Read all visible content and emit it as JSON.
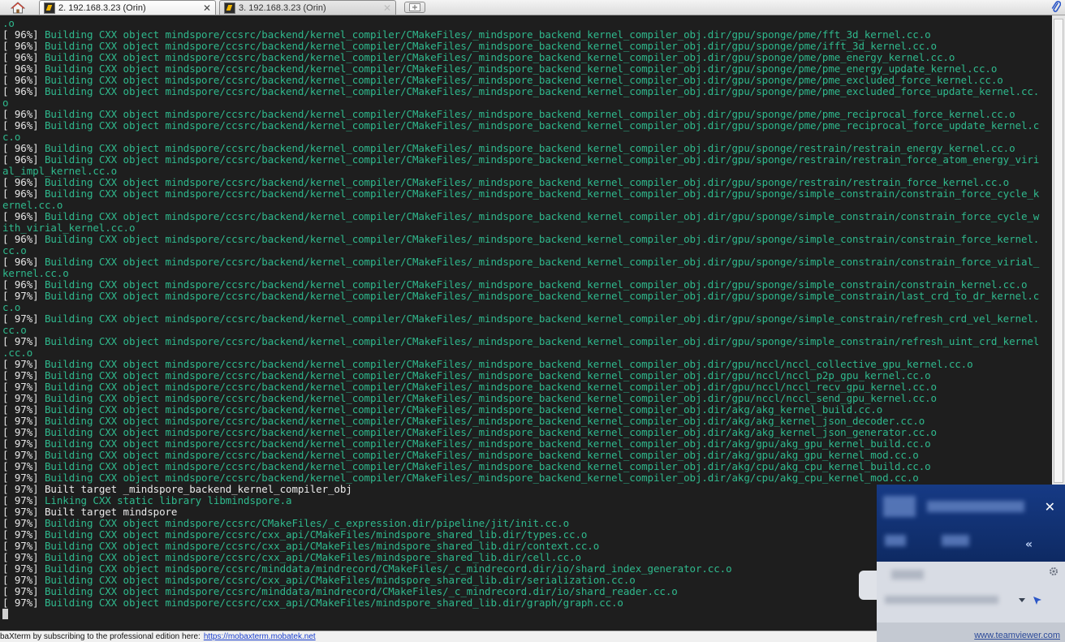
{
  "tabs": [
    {
      "label": "2. 192.168.3.23 (Orin)",
      "active": true
    },
    {
      "label": "3. 192.168.3.23 (Orin)",
      "active": false
    }
  ],
  "colors": {
    "green_text": "#2fb98d",
    "white_text": "#eaeaea",
    "background": "#1e1e1e"
  },
  "icons": {
    "home": "home-icon",
    "terminal_tab": "ssh-terminal-icon",
    "new_tab": "new-tab-icon",
    "attach": "paperclip-icon",
    "close": "close-icon"
  },
  "terminal": {
    "lines": [
      {
        "type": "cont",
        "text": ".o"
      },
      {
        "type": "green",
        "pct": "[ 96%]",
        "msg": " Building CXX object mindspore/ccsrc/backend/kernel_compiler/CMakeFiles/_mindspore_backend_kernel_compiler_obj.dir/gpu/sponge/pme/fft_3d_kernel.cc.o"
      },
      {
        "type": "green",
        "pct": "[ 96%]",
        "msg": " Building CXX object mindspore/ccsrc/backend/kernel_compiler/CMakeFiles/_mindspore_backend_kernel_compiler_obj.dir/gpu/sponge/pme/ifft_3d_kernel.cc.o"
      },
      {
        "type": "green",
        "pct": "[ 96%]",
        "msg": " Building CXX object mindspore/ccsrc/backend/kernel_compiler/CMakeFiles/_mindspore_backend_kernel_compiler_obj.dir/gpu/sponge/pme/pme_energy_kernel.cc.o"
      },
      {
        "type": "green",
        "pct": "[ 96%]",
        "msg": " Building CXX object mindspore/ccsrc/backend/kernel_compiler/CMakeFiles/_mindspore_backend_kernel_compiler_obj.dir/gpu/sponge/pme/pme_energy_update_kernel.cc.o"
      },
      {
        "type": "green",
        "pct": "[ 96%]",
        "msg": " Building CXX object mindspore/ccsrc/backend/kernel_compiler/CMakeFiles/_mindspore_backend_kernel_compiler_obj.dir/gpu/sponge/pme/pme_excluded_force_kernel.cc.o"
      },
      {
        "type": "green",
        "pct": "[ 96%]",
        "msg": " Building CXX object mindspore/ccsrc/backend/kernel_compiler/CMakeFiles/_mindspore_backend_kernel_compiler_obj.dir/gpu/sponge/pme/pme_excluded_force_update_kernel.cc."
      },
      {
        "type": "cont",
        "text": "o"
      },
      {
        "type": "green",
        "pct": "[ 96%]",
        "msg": " Building CXX object mindspore/ccsrc/backend/kernel_compiler/CMakeFiles/_mindspore_backend_kernel_compiler_obj.dir/gpu/sponge/pme/pme_reciprocal_force_kernel.cc.o"
      },
      {
        "type": "green",
        "pct": "[ 96%]",
        "msg": " Building CXX object mindspore/ccsrc/backend/kernel_compiler/CMakeFiles/_mindspore_backend_kernel_compiler_obj.dir/gpu/sponge/pme/pme_reciprocal_force_update_kernel.c"
      },
      {
        "type": "cont",
        "text": "c.o"
      },
      {
        "type": "green",
        "pct": "[ 96%]",
        "msg": " Building CXX object mindspore/ccsrc/backend/kernel_compiler/CMakeFiles/_mindspore_backend_kernel_compiler_obj.dir/gpu/sponge/restrain/restrain_energy_kernel.cc.o"
      },
      {
        "type": "green",
        "pct": "[ 96%]",
        "msg": " Building CXX object mindspore/ccsrc/backend/kernel_compiler/CMakeFiles/_mindspore_backend_kernel_compiler_obj.dir/gpu/sponge/restrain/restrain_force_atom_energy_viri"
      },
      {
        "type": "cont",
        "text": "al_impl_kernel.cc.o"
      },
      {
        "type": "green",
        "pct": "[ 96%]",
        "msg": " Building CXX object mindspore/ccsrc/backend/kernel_compiler/CMakeFiles/_mindspore_backend_kernel_compiler_obj.dir/gpu/sponge/restrain/restrain_force_kernel.cc.o"
      },
      {
        "type": "green",
        "pct": "[ 96%]",
        "msg": " Building CXX object mindspore/ccsrc/backend/kernel_compiler/CMakeFiles/_mindspore_backend_kernel_compiler_obj.dir/gpu/sponge/simple_constrain/constrain_force_cycle_k"
      },
      {
        "type": "cont",
        "text": "ernel.cc.o"
      },
      {
        "type": "green",
        "pct": "[ 96%]",
        "msg": " Building CXX object mindspore/ccsrc/backend/kernel_compiler/CMakeFiles/_mindspore_backend_kernel_compiler_obj.dir/gpu/sponge/simple_constrain/constrain_force_cycle_w"
      },
      {
        "type": "cont",
        "text": "ith_virial_kernel.cc.o"
      },
      {
        "type": "green",
        "pct": "[ 96%]",
        "msg": " Building CXX object mindspore/ccsrc/backend/kernel_compiler/CMakeFiles/_mindspore_backend_kernel_compiler_obj.dir/gpu/sponge/simple_constrain/constrain_force_kernel."
      },
      {
        "type": "cont",
        "text": "cc.o"
      },
      {
        "type": "green",
        "pct": "[ 96%]",
        "msg": " Building CXX object mindspore/ccsrc/backend/kernel_compiler/CMakeFiles/_mindspore_backend_kernel_compiler_obj.dir/gpu/sponge/simple_constrain/constrain_force_virial_"
      },
      {
        "type": "cont",
        "text": "kernel.cc.o"
      },
      {
        "type": "green",
        "pct": "[ 96%]",
        "msg": " Building CXX object mindspore/ccsrc/backend/kernel_compiler/CMakeFiles/_mindspore_backend_kernel_compiler_obj.dir/gpu/sponge/simple_constrain/constrain_kernel.cc.o"
      },
      {
        "type": "green",
        "pct": "[ 97%]",
        "msg": " Building CXX object mindspore/ccsrc/backend/kernel_compiler/CMakeFiles/_mindspore_backend_kernel_compiler_obj.dir/gpu/sponge/simple_constrain/last_crd_to_dr_kernel.c"
      },
      {
        "type": "cont",
        "text": "c.o"
      },
      {
        "type": "green",
        "pct": "[ 97%]",
        "msg": " Building CXX object mindspore/ccsrc/backend/kernel_compiler/CMakeFiles/_mindspore_backend_kernel_compiler_obj.dir/gpu/sponge/simple_constrain/refresh_crd_vel_kernel."
      },
      {
        "type": "cont",
        "text": "cc.o"
      },
      {
        "type": "green",
        "pct": "[ 97%]",
        "msg": " Building CXX object mindspore/ccsrc/backend/kernel_compiler/CMakeFiles/_mindspore_backend_kernel_compiler_obj.dir/gpu/sponge/simple_constrain/refresh_uint_crd_kernel"
      },
      {
        "type": "cont",
        "text": ".cc.o"
      },
      {
        "type": "green",
        "pct": "[ 97%]",
        "msg": " Building CXX object mindspore/ccsrc/backend/kernel_compiler/CMakeFiles/_mindspore_backend_kernel_compiler_obj.dir/gpu/nccl/nccl_collective_gpu_kernel.cc.o"
      },
      {
        "type": "green",
        "pct": "[ 97%]",
        "msg": " Building CXX object mindspore/ccsrc/backend/kernel_compiler/CMakeFiles/_mindspore_backend_kernel_compiler_obj.dir/gpu/nccl/nccl_p2p_gpu_kernel.cc.o"
      },
      {
        "type": "green",
        "pct": "[ 97%]",
        "msg": " Building CXX object mindspore/ccsrc/backend/kernel_compiler/CMakeFiles/_mindspore_backend_kernel_compiler_obj.dir/gpu/nccl/nccl_recv_gpu_kernel.cc.o"
      },
      {
        "type": "green",
        "pct": "[ 97%]",
        "msg": " Building CXX object mindspore/ccsrc/backend/kernel_compiler/CMakeFiles/_mindspore_backend_kernel_compiler_obj.dir/gpu/nccl/nccl_send_gpu_kernel.cc.o"
      },
      {
        "type": "green",
        "pct": "[ 97%]",
        "msg": " Building CXX object mindspore/ccsrc/backend/kernel_compiler/CMakeFiles/_mindspore_backend_kernel_compiler_obj.dir/akg/akg_kernel_build.cc.o"
      },
      {
        "type": "green",
        "pct": "[ 97%]",
        "msg": " Building CXX object mindspore/ccsrc/backend/kernel_compiler/CMakeFiles/_mindspore_backend_kernel_compiler_obj.dir/akg/akg_kernel_json_decoder.cc.o"
      },
      {
        "type": "green",
        "pct": "[ 97%]",
        "msg": " Building CXX object mindspore/ccsrc/backend/kernel_compiler/CMakeFiles/_mindspore_backend_kernel_compiler_obj.dir/akg/akg_kernel_json_generator.cc.o"
      },
      {
        "type": "green",
        "pct": "[ 97%]",
        "msg": " Building CXX object mindspore/ccsrc/backend/kernel_compiler/CMakeFiles/_mindspore_backend_kernel_compiler_obj.dir/akg/gpu/akg_gpu_kernel_build.cc.o"
      },
      {
        "type": "green",
        "pct": "[ 97%]",
        "msg": " Building CXX object mindspore/ccsrc/backend/kernel_compiler/CMakeFiles/_mindspore_backend_kernel_compiler_obj.dir/akg/gpu/akg_gpu_kernel_mod.cc.o"
      },
      {
        "type": "green",
        "pct": "[ 97%]",
        "msg": " Building CXX object mindspore/ccsrc/backend/kernel_compiler/CMakeFiles/_mindspore_backend_kernel_compiler_obj.dir/akg/cpu/akg_cpu_kernel_build.cc.o"
      },
      {
        "type": "green",
        "pct": "[ 97%]",
        "msg": " Building CXX object mindspore/ccsrc/backend/kernel_compiler/CMakeFiles/_mindspore_backend_kernel_compiler_obj.dir/akg/cpu/akg_cpu_kernel_mod.cc.o"
      },
      {
        "type": "white",
        "pct": "[ 97%]",
        "msg": " Built target _mindspore_backend_kernel_compiler_obj"
      },
      {
        "type": "green",
        "pct": "[ 97%]",
        "msg": " Linking CXX static library libmindspore.a"
      },
      {
        "type": "white",
        "pct": "[ 97%]",
        "msg": " Built target mindspore"
      },
      {
        "type": "green",
        "pct": "[ 97%]",
        "msg": " Building CXX object mindspore/ccsrc/CMakeFiles/_c_expression.dir/pipeline/jit/init.cc.o"
      },
      {
        "type": "green",
        "pct": "[ 97%]",
        "msg": " Building CXX object mindspore/ccsrc/cxx_api/CMakeFiles/mindspore_shared_lib.dir/types.cc.o"
      },
      {
        "type": "green",
        "pct": "[ 97%]",
        "msg": " Building CXX object mindspore/ccsrc/cxx_api/CMakeFiles/mindspore_shared_lib.dir/context.cc.o"
      },
      {
        "type": "green",
        "pct": "[ 97%]",
        "msg": " Building CXX object mindspore/ccsrc/cxx_api/CMakeFiles/mindspore_shared_lib.dir/cell.cc.o"
      },
      {
        "type": "green",
        "pct": "[ 97%]",
        "msg": " Building CXX object mindspore/ccsrc/minddata/mindrecord/CMakeFiles/_c_mindrecord.dir/io/shard_index_generator.cc.o"
      },
      {
        "type": "green",
        "pct": "[ 97%]",
        "msg": " Building CXX object mindspore/ccsrc/cxx_api/CMakeFiles/mindspore_shared_lib.dir/serialization.cc.o"
      },
      {
        "type": "green",
        "pct": "[ 97%]",
        "msg": " Building CXX object mindspore/ccsrc/minddata/mindrecord/CMakeFiles/_c_mindrecord.dir/io/shard_reader.cc.o"
      },
      {
        "type": "green",
        "pct": "[ 97%]",
        "msg": " Building CXX object mindspore/ccsrc/cxx_api/CMakeFiles/mindspore_shared_lib.dir/graph/graph.cc.o"
      }
    ]
  },
  "statusbar": {
    "text": "baXterm by subscribing to the professional edition here:",
    "link": "https://mobaxterm.mobatek.net"
  },
  "teamviewer": {
    "link": "www.teamviewer.com"
  }
}
